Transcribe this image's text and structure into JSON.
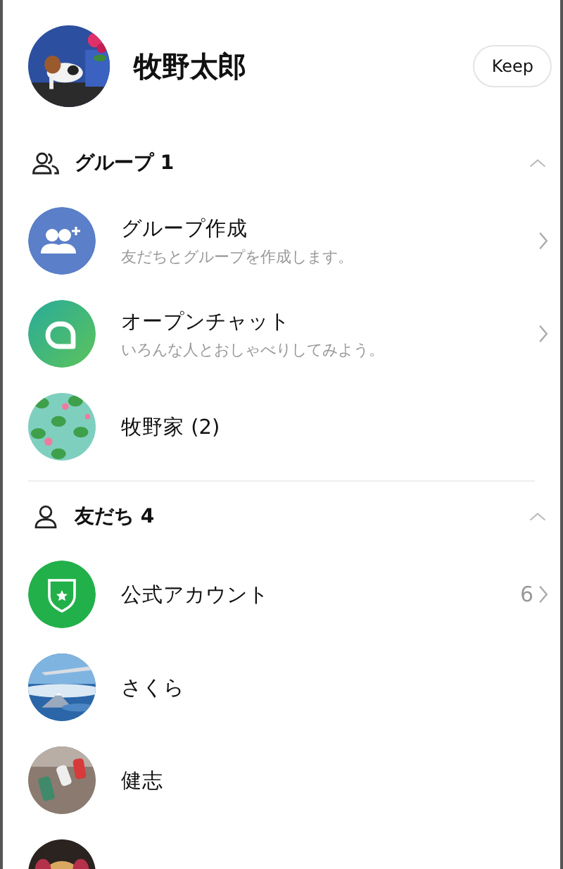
{
  "profile": {
    "name": "牧野太郎",
    "avatar": {
      "kind": "picture"
    },
    "button": "Keep"
  },
  "sections": [
    {
      "title": "グループ 1",
      "kind": "group",
      "expanded": true,
      "items": [
        {
          "kind": "group-add",
          "title": "グループ作成",
          "subtitle": "友だちとグループを作成します。",
          "chevron": true
        },
        {
          "kind": "open-chat",
          "title": "オープンチャット",
          "subtitle": "いろんな人とおしゃべりしてみよう。",
          "chevron": true
        },
        {
          "kind": "picture",
          "title": "牧野家 (2)",
          "chevron": false
        }
      ]
    },
    {
      "title": "友だち 4",
      "kind": "person",
      "expanded": true,
      "items": [
        {
          "kind": "official",
          "title": "公式アカウント",
          "count": "6",
          "chevron": true
        },
        {
          "kind": "picture",
          "title": "さくら",
          "chevron": false
        },
        {
          "kind": "picture",
          "title": "健志",
          "chevron": false
        },
        {
          "kind": "picture",
          "chevron": false
        }
      ]
    }
  ]
}
